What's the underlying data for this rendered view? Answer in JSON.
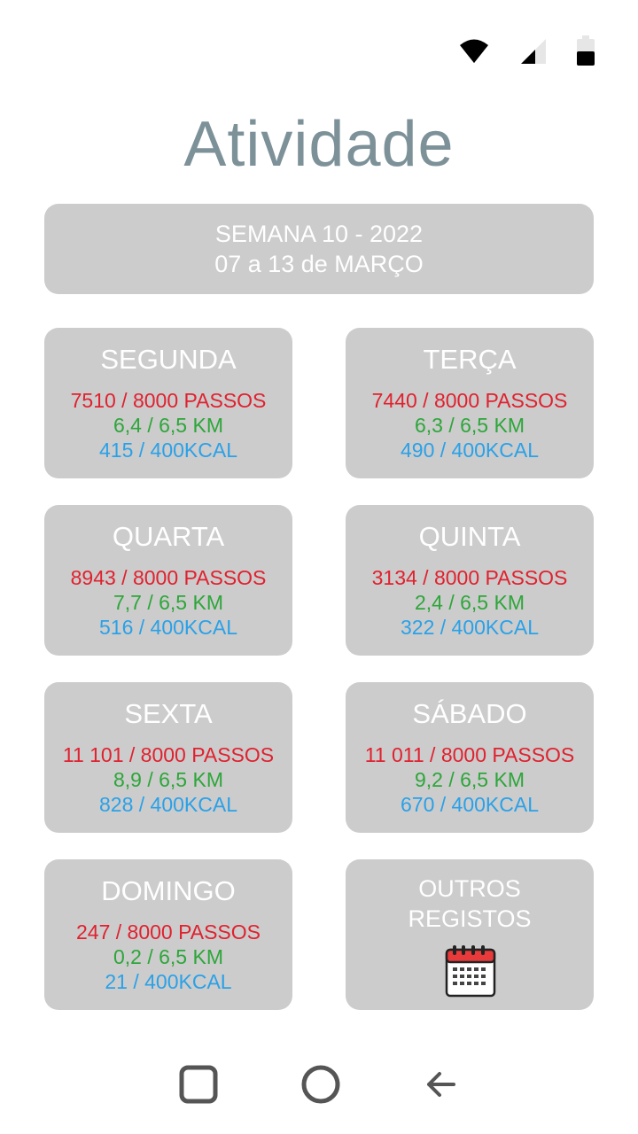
{
  "status_bar": {
    "icons": [
      "wifi-icon",
      "signal-icon",
      "battery-icon"
    ]
  },
  "title": "Atividade",
  "week": {
    "line1": "SEMANA 10 - 2022",
    "line2": "07 a 13 de MARÇO"
  },
  "days": [
    {
      "name": "SEGUNDA",
      "steps": "7510 / 8000 PASSOS",
      "km": "6,4 / 6,5 KM",
      "kcal": "415 / 400KCAL"
    },
    {
      "name": "TERÇA",
      "steps": "7440 / 8000 PASSOS",
      "km": "6,3 / 6,5 KM",
      "kcal": "490 / 400KCAL"
    },
    {
      "name": "QUARTA",
      "steps": "8943 / 8000 PASSOS",
      "km": "7,7 / 6,5 KM",
      "kcal": "516 / 400KCAL"
    },
    {
      "name": "QUINTA",
      "steps": "3134 / 8000 PASSOS",
      "km": "2,4 / 6,5 KM",
      "kcal": "322 / 400KCAL"
    },
    {
      "name": "SEXTA",
      "steps": "11 101 / 8000 PASSOS",
      "km": "8,9 / 6,5 KM",
      "kcal": "828 / 400KCAL"
    },
    {
      "name": "SÁBADO",
      "steps": "11 011 / 8000 PASSOS",
      "km": "9,2 / 6,5 KM",
      "kcal": "670 / 400KCAL"
    },
    {
      "name": "DOMINGO",
      "steps": "247 / 8000 PASSOS",
      "km": "0,2 / 6,5 KM",
      "kcal": "21 / 400KCAL"
    }
  ],
  "other": {
    "line1": "OUTROS",
    "line2": "REGISTOS",
    "icon": "calendar-icon"
  },
  "colors": {
    "title": "#7d9199",
    "card": "#cccccc",
    "steps": "#e0212f",
    "km": "#2da63a",
    "kcal": "#2aa1e8"
  },
  "nav": {
    "icons": [
      "recents-icon",
      "home-icon",
      "back-icon"
    ]
  }
}
